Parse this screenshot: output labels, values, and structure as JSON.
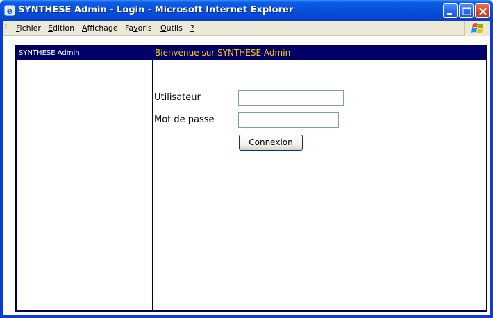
{
  "window": {
    "title": "SYNTHESE Admin - Login - Microsoft Internet Explorer"
  },
  "menu": {
    "items": [
      {
        "label": "Fichier",
        "underline": "F"
      },
      {
        "label": "Edition",
        "underline": "E"
      },
      {
        "label": "Affichage",
        "underline": "A"
      },
      {
        "label": "Favoris",
        "underline": "v"
      },
      {
        "label": "Outils",
        "underline": "O"
      },
      {
        "label": "?",
        "underline": "?"
      }
    ]
  },
  "page": {
    "header_left": "SYNTHESE Admin",
    "header_right": "Bienvenue sur SYNTHESE Admin",
    "colors": {
      "header_bg": "#000066",
      "header_right_text": "#ffcc00",
      "border": "#00005a"
    }
  },
  "form": {
    "user_label": "Utilisateur",
    "user_value": "",
    "password_label": "Mot de passe",
    "password_value": "",
    "submit_label": "Connexion"
  }
}
